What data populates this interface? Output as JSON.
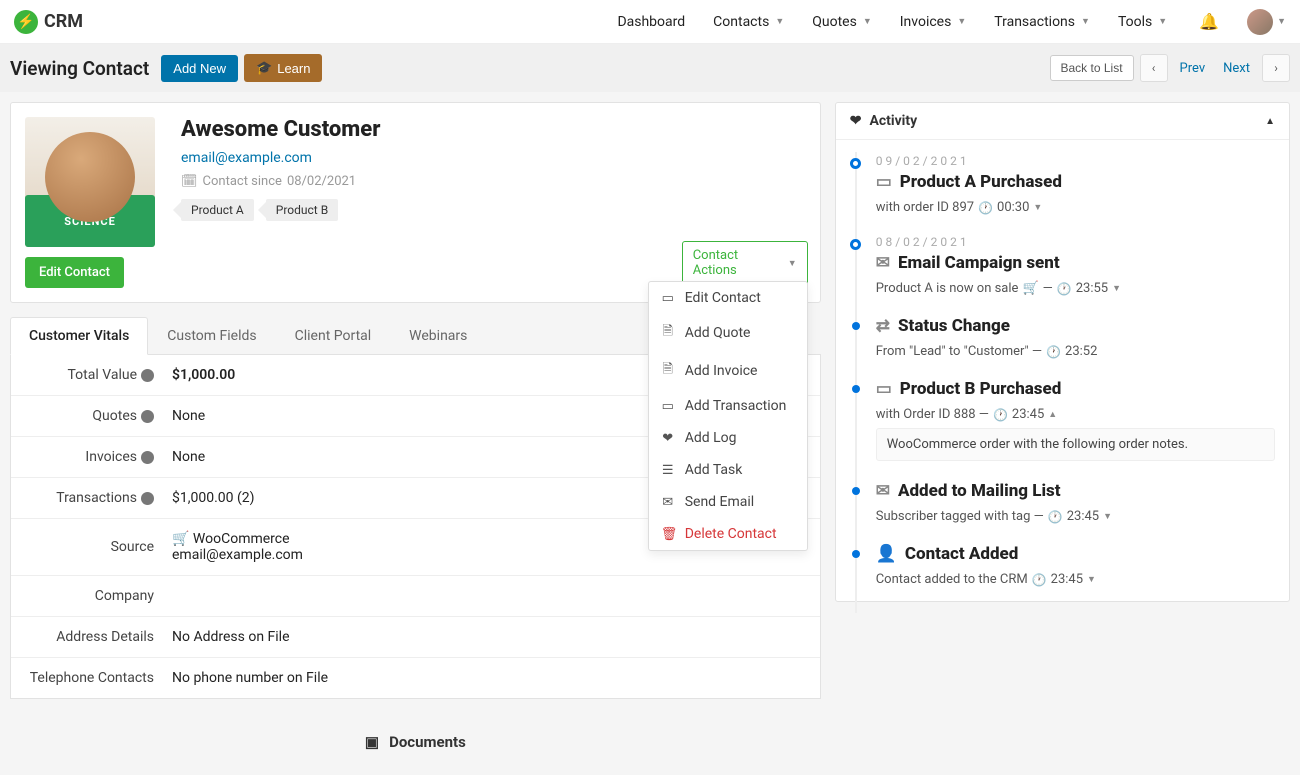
{
  "app": {
    "name": "CRM"
  },
  "topnav": {
    "dashboard": "Dashboard",
    "contacts": "Contacts",
    "quotes": "Quotes",
    "invoices": "Invoices",
    "transactions": "Transactions",
    "tools": "Tools"
  },
  "header": {
    "title": "Viewing Contact",
    "add_new": "Add New",
    "learn": "Learn",
    "back": "Back to List",
    "prev": "Prev",
    "next": "Next"
  },
  "contact": {
    "name": "Awesome Customer",
    "email": "email@example.com",
    "since_prefix": "Contact since",
    "since_date": "08/02/2021",
    "tags": {
      "a": "Product A",
      "b": "Product B"
    },
    "edit": "Edit Contact",
    "shirt": "SCIENCE"
  },
  "actions": {
    "trigger": "Contact Actions",
    "edit": "Edit Contact",
    "add_quote": "Add Quote",
    "add_invoice": "Add Invoice",
    "add_transaction": "Add Transaction",
    "add_log": "Add Log",
    "add_task": "Add Task",
    "send_email": "Send Email",
    "delete": "Delete Contact"
  },
  "tabs": {
    "vitals": "Customer Vitals",
    "custom": "Custom Fields",
    "portal": "Client Portal",
    "webinars": "Webinars"
  },
  "vitals": {
    "total_label": "Total Value",
    "total_value": "$1,000.00",
    "quotes_label": "Quotes",
    "quotes_value": "None",
    "invoices_label": "Invoices",
    "invoices_value": "None",
    "transactions_label": "Transactions",
    "transactions_value": "$1,000.00 (2)",
    "source_label": "Source",
    "source_value": "WooCommerce",
    "source_sub": "email@example.com",
    "company_label": "Company",
    "company_value": "",
    "address_label": "Address Details",
    "address_value": "No Address on File",
    "phone_label": "Telephone Contacts",
    "phone_value": "No phone number on File"
  },
  "docs": {
    "title": "Documents"
  },
  "activity": {
    "title": "Activity",
    "items": [
      {
        "date": "09/02/2021",
        "title": "Product A Purchased",
        "sub": "with order ID 897",
        "time": "00:30"
      },
      {
        "date": "08/02/2021",
        "title": "Email Campaign sent",
        "sub": "Product A is now on sale",
        "time": "23:55"
      },
      {
        "title": "Status Change",
        "sub": "From \"Lead\" to \"Customer\" —",
        "time": "23:52"
      },
      {
        "title": "Product B Purchased",
        "sub": "with Order ID 888 —",
        "time": "23:45",
        "note": "WooCommerce order with the following order notes."
      },
      {
        "title": "Added to Mailing List",
        "sub": "Subscriber tagged with tag —",
        "time": "23:45"
      },
      {
        "title": "Contact Added",
        "sub": "Contact added to the CRM",
        "time": "23:45"
      }
    ]
  }
}
